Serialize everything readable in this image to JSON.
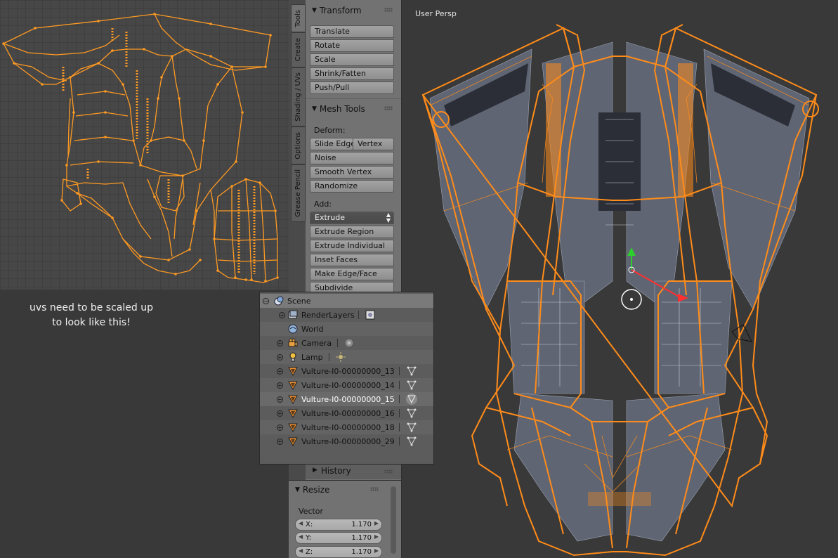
{
  "note": {
    "line1": "uvs need to be scaled up",
    "line2": "to look like this!"
  },
  "tabs": [
    {
      "label": "Tools",
      "active": true
    },
    {
      "label": "Create",
      "active": false
    },
    {
      "label": "Shading / UVs",
      "active": false
    },
    {
      "label": "Options",
      "active": false
    },
    {
      "label": "Grease Pencil",
      "active": false
    }
  ],
  "transform": {
    "title": "Transform",
    "buttons": [
      "Translate",
      "Rotate",
      "Scale",
      "Shrink/Fatten",
      "Push/Pull"
    ]
  },
  "mesh_tools": {
    "title": "Mesh Tools",
    "deform_label": "Deform:",
    "slide_edge": "Slide Edge",
    "vertex": "Vertex",
    "deform_buttons": [
      "Noise",
      "Smooth Vertex",
      "Randomize"
    ],
    "add_label": "Add:",
    "extrude_select": "Extrude",
    "add_buttons": [
      "Extrude Region",
      "Extrude Individual",
      "Inset Faces",
      "Make Edge/Face",
      "Subdivide"
    ]
  },
  "outliner": {
    "rows": [
      {
        "name": "Scene",
        "icon": "scene-icon",
        "right_icon": ""
      },
      {
        "name": "RenderLayers",
        "icon": "renderlayers-icon",
        "right_icon": "render-icon"
      },
      {
        "name": "World",
        "icon": "world-icon",
        "right_icon": ""
      },
      {
        "name": "Camera",
        "icon": "camera-icon",
        "right_icon": "camera-data-icon"
      },
      {
        "name": "Lamp",
        "icon": "lamp-icon",
        "right_icon": "lamp-data-icon"
      },
      {
        "name": "Vulture-I0-00000000_13",
        "icon": "mesh-icon",
        "right_icon": "mesh-data-icon"
      },
      {
        "name": "Vulture-I0-00000000_14",
        "icon": "mesh-icon",
        "right_icon": "mesh-data-icon"
      },
      {
        "name": "Vulture-I0-00000000_15",
        "icon": "mesh-icon",
        "right_icon": "mesh-data-icon",
        "selected": true
      },
      {
        "name": "Vulture-I0-00000000_16",
        "icon": "mesh-icon",
        "right_icon": "mesh-data-icon"
      },
      {
        "name": "Vulture-I0-00000000_18",
        "icon": "mesh-icon",
        "right_icon": "mesh-data-icon"
      },
      {
        "name": "Vulture-I0-00000000_29",
        "icon": "mesh-icon",
        "right_icon": "mesh-data-icon"
      }
    ]
  },
  "history": {
    "title": "History"
  },
  "resize": {
    "title": "Resize",
    "vector_label": "Vector",
    "fields": [
      {
        "label": "X:",
        "value": "1.170"
      },
      {
        "label": "Y:",
        "value": "1.170"
      },
      {
        "label": "Z:",
        "value": "1.170"
      }
    ]
  },
  "viewport": {
    "label": "User Persp"
  },
  "colors": {
    "wire_selected": "#ff8c1a",
    "panel": "#727272",
    "background": "#393939"
  }
}
